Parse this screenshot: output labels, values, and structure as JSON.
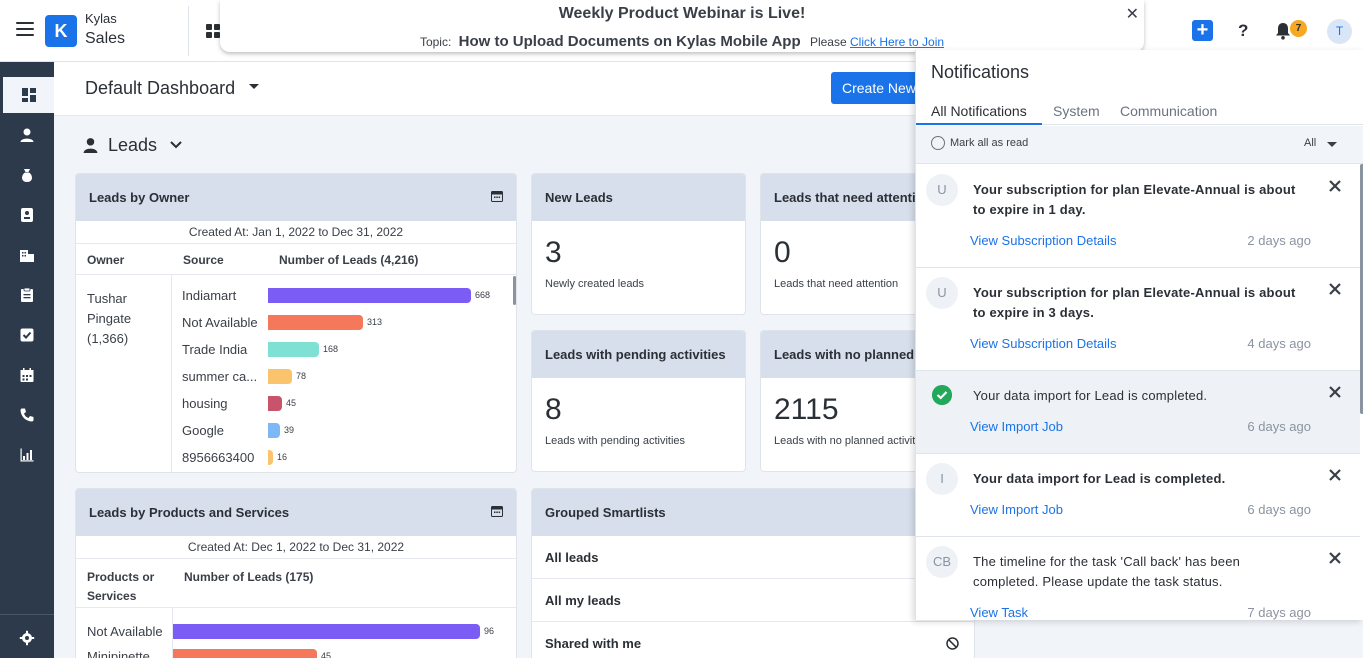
{
  "app": {
    "name": "Kylas",
    "module": "Sales",
    "logo_text": "K"
  },
  "banner": {
    "title": "Weekly Product Webinar is Live!",
    "topic_label": "Topic:",
    "topic": "How to Upload Documents on Kylas Mobile App",
    "please": "Please",
    "link": "Click Here to Join"
  },
  "topbar": {
    "notification_count": "7",
    "avatar_initial": "T"
  },
  "dashboard": {
    "title": "Default Dashboard",
    "create_button": "Create New",
    "entity": "Leads"
  },
  "leads_by_owner": {
    "title": "Leads by Owner",
    "created_at": "Created At: Jan 1, 2022 to Dec 31, 2022",
    "columns": [
      "Owner",
      "Source",
      "Number of Leads (4,216)"
    ],
    "owner": "Tushar\nPingate\n(1,366)",
    "owner_lines": [
      "Tushar",
      "Pingate",
      "(1,366)"
    ],
    "rows": [
      {
        "source": "Indiamart",
        "value": 668,
        "color": "#7b5cf5"
      },
      {
        "source": "Not Available",
        "value": 313,
        "color": "#f5785b"
      },
      {
        "source": "Trade India",
        "value": 168,
        "color": "#7fe0d4"
      },
      {
        "source": "summer ca...",
        "value": 78,
        "color": "#f9c46b"
      },
      {
        "source": "housing",
        "value": 45,
        "color": "#c7546a"
      },
      {
        "source": "Google",
        "value": 39,
        "color": "#7cb8f5"
      },
      {
        "source": "8956663400",
        "value": 16,
        "color": "#f9c46b"
      }
    ]
  },
  "leads_by_products": {
    "title": "Leads by Products and Services",
    "created_at": "Created At: Dec 1, 2022 to Dec 31, 2022",
    "col1": "Products or\nServices",
    "col1_lines": [
      "Products or",
      "Services"
    ],
    "col2": "Number of Leads (175)",
    "rows": [
      {
        "label": "Not Available",
        "value": 96,
        "color": "#7b5cf5"
      },
      {
        "label": "Minipinette",
        "value": 45,
        "color": "#f5785b"
      }
    ]
  },
  "metrics": [
    {
      "title": "New Leads",
      "value": "3",
      "sub": "Newly created leads"
    },
    {
      "title": "Leads that need attention",
      "value": "0",
      "sub": "Leads that need attention"
    },
    {
      "title": "Leads with pending activities",
      "value": "8",
      "sub": "Leads with pending activities"
    },
    {
      "title": "Leads with no planned activities",
      "value": "2115",
      "sub": "Leads with no planned activities"
    }
  ],
  "smartlists": {
    "title": "Grouped Smartlists",
    "items": [
      "All leads",
      "All my leads",
      "Shared with me"
    ]
  },
  "notifications": {
    "title": "Notifications",
    "tabs": [
      "All Notifications",
      "System",
      "Communication"
    ],
    "mark_all": "Mark all as read",
    "filter": "All",
    "items": [
      {
        "avatar": "U",
        "text": "Your subscription for plan Elevate-Annual is about to expire in 1 day.",
        "link": "View Subscription Details",
        "time": "2 days ago"
      },
      {
        "avatar": "U",
        "text": "Your subscription for plan Elevate-Annual is about to expire in 3 days.",
        "link": "View Subscription Details",
        "time": "4 days ago"
      },
      {
        "avatar": "",
        "text": "Your data import for Lead is completed.",
        "link": "View Import Job",
        "time": "6 days ago"
      },
      {
        "avatar": "I",
        "text": "Your data import for Lead is completed.",
        "link": "View Import Job",
        "time": "6 days ago"
      },
      {
        "avatar": "CB",
        "text": "The timeline for the task 'Call back' has been completed. Please update the task status.",
        "link": "View Task",
        "time": "7 days ago"
      }
    ]
  }
}
